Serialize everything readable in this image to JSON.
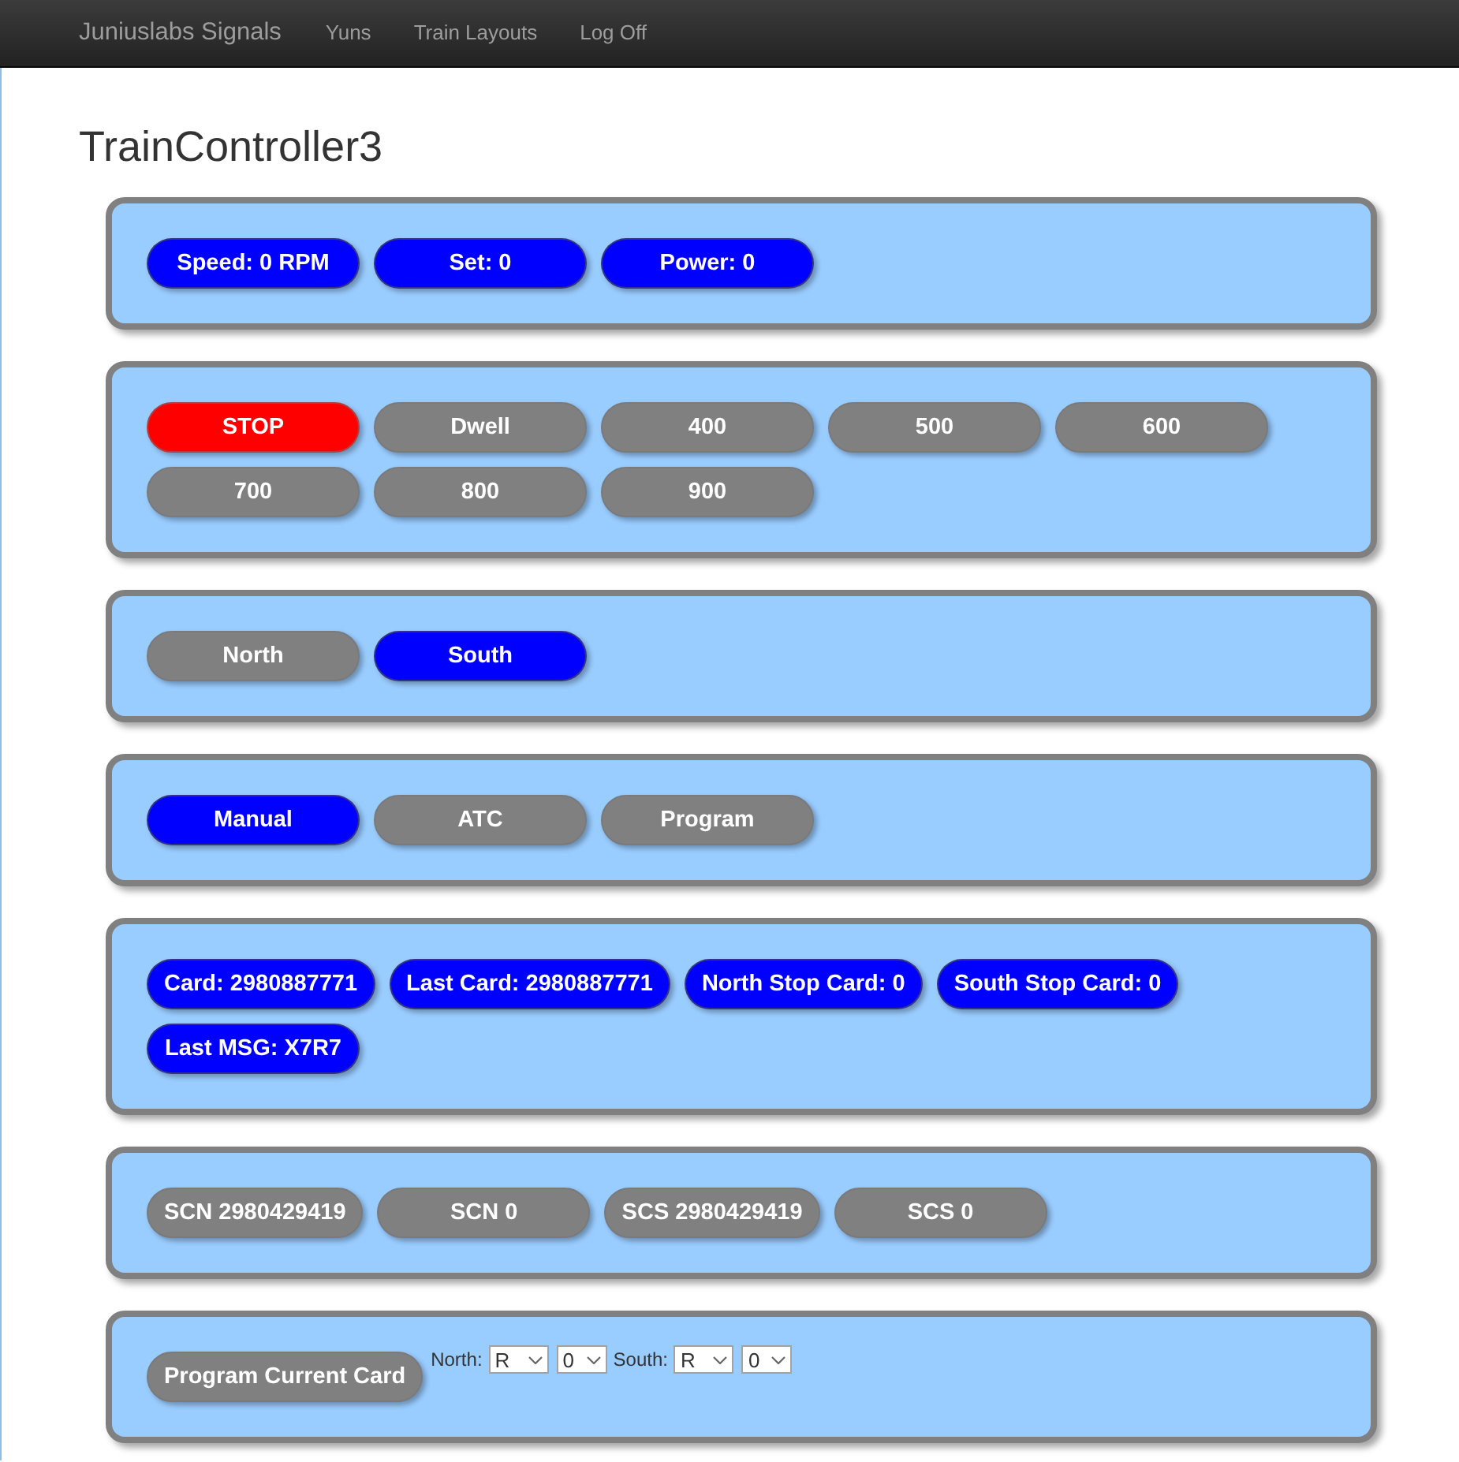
{
  "navbar": {
    "brand": "Juniuslabs Signals",
    "links": [
      "Yuns",
      "Train Layouts",
      "Log Off"
    ]
  },
  "page_title": "TrainController3",
  "panels": [
    {
      "kind": "readouts",
      "items": [
        {
          "label": "Speed: 0 RPM"
        },
        {
          "label": "Set: 0"
        },
        {
          "label": "Power: 0"
        }
      ]
    },
    {
      "kind": "speed",
      "items": [
        {
          "label": "STOP",
          "kind": "stop",
          "selected": true
        },
        {
          "label": "Dwell",
          "selected": false
        },
        {
          "label": "400",
          "selected": false
        },
        {
          "label": "500",
          "selected": false
        },
        {
          "label": "600",
          "selected": false
        },
        {
          "label": "700",
          "selected": false
        },
        {
          "label": "800",
          "selected": false
        },
        {
          "label": "900",
          "selected": false
        }
      ]
    },
    {
      "kind": "direction",
      "items": [
        {
          "label": "North",
          "selected": false
        },
        {
          "label": "South",
          "selected": true
        }
      ]
    },
    {
      "kind": "mode",
      "items": [
        {
          "label": "Manual",
          "selected": true
        },
        {
          "label": "ATC",
          "selected": false
        },
        {
          "label": "Program",
          "selected": false
        }
      ]
    },
    {
      "kind": "readouts",
      "items": [
        {
          "label": "Card: 2980887771"
        },
        {
          "label": "Last Card: 2980887771"
        },
        {
          "label": "North Stop Card: 0"
        },
        {
          "label": "South Stop Card: 0"
        },
        {
          "label": "Last MSG: X7R7"
        }
      ]
    },
    {
      "kind": "commands",
      "items": [
        {
          "label": "SCN 2980429419"
        },
        {
          "label": "SCN 0"
        },
        {
          "label": "SCS 2980429419"
        },
        {
          "label": "SCS 0"
        }
      ]
    },
    {
      "kind": "program",
      "button": "Program Current Card",
      "fields": [
        {
          "label": "North:",
          "selects": [
            "R",
            "0"
          ]
        },
        {
          "label": "South:",
          "selects": [
            "R",
            "0"
          ]
        }
      ]
    }
  ]
}
